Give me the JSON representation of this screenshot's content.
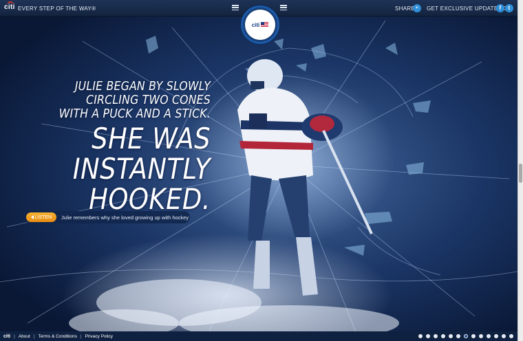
{
  "header": {
    "brand": "citi",
    "tagline": "EVERY STEP OF THE WAY®",
    "share_label": "SHARE",
    "updates_label": "GET EXCLUSIVE UPDATES ON",
    "facebook_glyph": "f",
    "twitter_glyph": "t"
  },
  "badge": {
    "brand": "citi"
  },
  "story": {
    "line1": "JULIE BEGAN BY SLOWLY",
    "line2": "CIRCLING TWO CONES",
    "line3": "WITH A PUCK AND A STICK.",
    "big1": "SHE WAS",
    "big2": "INSTANTLY",
    "big3": "HOOKED."
  },
  "listen": {
    "button_label": "LISTEN",
    "caption": "Julie remembers why she loved growing up with hockey"
  },
  "footer": {
    "brand": "citi",
    "links": [
      "About",
      "Terms & Conditions",
      "Privacy Policy"
    ]
  },
  "pagination": {
    "total": 13,
    "active_index": 6
  },
  "colors": {
    "accent_orange": "#f29d22",
    "social_blue": "#2f8ed8",
    "header_navy": "#14243f"
  },
  "icons": [
    "menu-icon",
    "share-icon",
    "facebook-icon",
    "twitter-icon",
    "speaker-icon"
  ]
}
